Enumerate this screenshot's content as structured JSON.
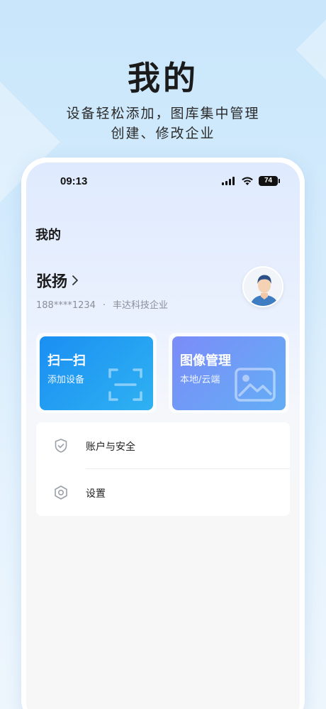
{
  "hero": {
    "title": "我的",
    "subtitle_line1": "设备轻松添加，图库集中管理",
    "subtitle_line2": "创建、修改企业"
  },
  "status_bar": {
    "time": "09:13",
    "battery": "74"
  },
  "page": {
    "title": "我的"
  },
  "user": {
    "name": "张扬",
    "phone": "188****1234",
    "separator": "·",
    "company": "丰达科技企业"
  },
  "cards": [
    {
      "title": "扫一扫",
      "desc": "添加设备",
      "icon": "scan-icon"
    },
    {
      "title": "图像管理",
      "desc": "本地/云端",
      "icon": "image-icon"
    }
  ],
  "menu": [
    {
      "label": "账户与安全",
      "icon": "shield-icon"
    },
    {
      "label": "设置",
      "icon": "gear-icon"
    }
  ],
  "colors": {
    "scan_card": "#1a8ff3",
    "image_card": "#7b8cf8",
    "background": "#c9e6fb"
  }
}
